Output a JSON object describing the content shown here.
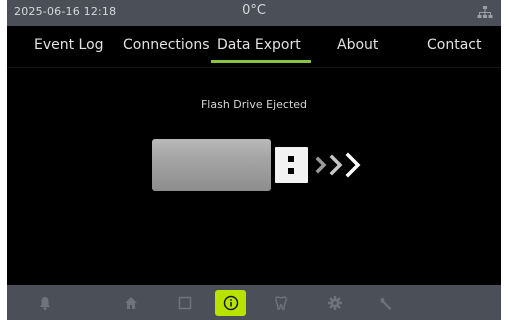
{
  "status_bar": {
    "datetime": "2025-06-16   12:18",
    "temperature": "0°C",
    "network_icon": "network-icon"
  },
  "tabs": [
    {
      "label": "Event Log",
      "active": false
    },
    {
      "label": "Connections",
      "active": false
    },
    {
      "label": "Data Export",
      "active": true
    },
    {
      "label": "About",
      "active": false
    },
    {
      "label": "Contact",
      "active": false
    }
  ],
  "main": {
    "status_text": "Flash Drive Ejected",
    "illustration_icon": "usb-drive-icon"
  },
  "nav": [
    {
      "icon": "bell-icon",
      "active": false
    },
    {
      "icon": "home-icon",
      "active": false
    },
    {
      "icon": "square-icon",
      "active": false
    },
    {
      "icon": "info-icon",
      "active": true
    },
    {
      "icon": "tooth-icon",
      "active": false
    },
    {
      "icon": "gear-icon",
      "active": false
    },
    {
      "icon": "wrench-icon",
      "active": false
    }
  ],
  "colors": {
    "accent": "#8ac43f",
    "active_button": "#b8e200",
    "bar_background": "#4b4f57",
    "screen_background": "#000000"
  }
}
